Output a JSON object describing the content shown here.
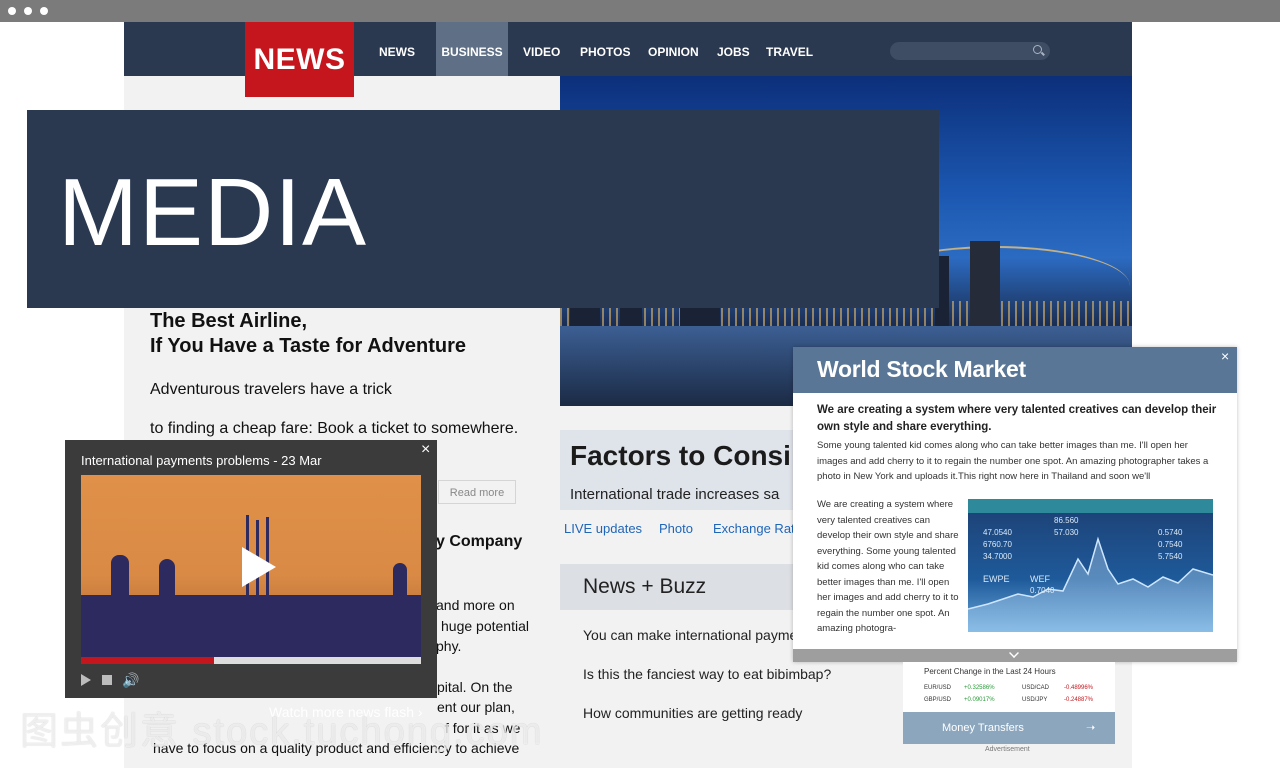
{
  "nav": {
    "logo": "NEWS",
    "items": [
      "NEWS",
      "BUSINESS",
      "VIDEO",
      "PHOTOS",
      "OPINION",
      "JOBS",
      "TRAVEL"
    ],
    "active": "BUSINESS"
  },
  "banner": {
    "title": "MEDIA"
  },
  "article": {
    "title_line1": "The Best Airline,",
    "title_line2": "If You Have a Taste for Adventure",
    "para1": "Adventurous travelers have a trick",
    "para2": "to finding a cheap fare: Book a ticket to somewhere.",
    "read_more": "Read more",
    "company_fragment": "y Company",
    "frag1": "and more on",
    "frag2": "huge potential",
    "frag3": "phy.",
    "frag4": "pital. On the",
    "frag5": "ent our plan,",
    "frag6": "f for it as we",
    "last_line": "have to focus on a quality product and efficiency to achieve"
  },
  "hero": {
    "factors_title": "Factors to Consi",
    "factors_sub": "International trade increases sa",
    "tabs": [
      "LIVE updates",
      "Photo",
      "Exchange Rat"
    ]
  },
  "buzz": {
    "title": "News + Buzz",
    "items": [
      "You can make international payme",
      "Is this the fanciest way to eat bibimbap?",
      "How communities are getting ready"
    ]
  },
  "video": {
    "title": "International payments problems - 23 Mar",
    "close": "×",
    "watch_more": "Watch more news flash",
    "progress": 0.39
  },
  "stock": {
    "title": "World Stock Market",
    "close": "×",
    "lead": "We are creating a system where very talented creatives can develop their own style and share everything.",
    "body1": "Some young talented kid comes along who can take better images than me. I'll open her images and add cherry to it to regain the number one spot. An amazing photographer takes a photo in New York and uploads it.This right now here in Thailand and soon we'll",
    "body2": "We are creating a system where very talented creatives can develop their own style and share everything. Some young talented kid comes along who can take better images than me. I'll open her images and add cherry to it to regain the number one spot. An amazing photogra-",
    "chart_labels": [
      "86.560",
      "47.0540",
      "6760.70",
      "34.7000",
      "57.030",
      "0.5740",
      "0.7540",
      "EWPE",
      "WEF",
      "0.7040",
      "5.7540"
    ]
  },
  "fx": {
    "title": "Percent Change in the Last 24 Hours",
    "rows": [
      {
        "pair": "EUR/USD",
        "change": "+0.32586%"
      },
      {
        "pair": "USD/CAD",
        "change": "-0.48996%"
      },
      {
        "pair": "GBP/USD",
        "change": "+0.09017%"
      },
      {
        "pair": "USD/JPY",
        "change": "-0.24887%"
      }
    ],
    "button": "Money Transfers",
    "advert": "Advertisement"
  },
  "watermark": "图虫创意 stock.tuchong.com",
  "colors": {
    "navy": "#2a3850",
    "red": "#c4161c",
    "stock_blue": "#5a7696"
  }
}
